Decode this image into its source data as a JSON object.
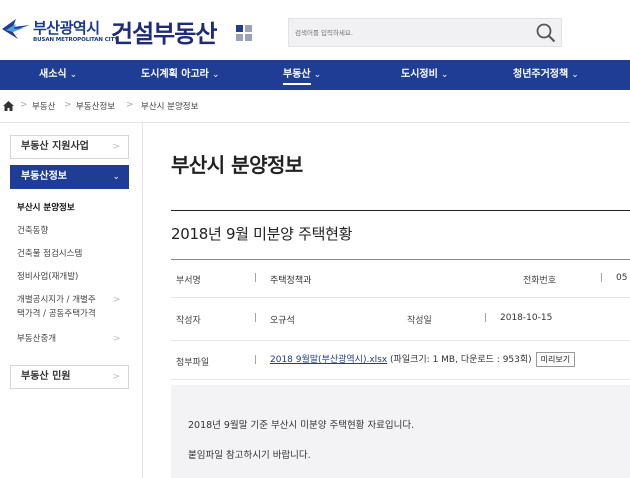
{
  "header": {
    "logo_korean": "부산광역시",
    "logo_english": "BUSAN METROPOLITAN CITY",
    "site_title": "건설부동산",
    "search_placeholder": "검색어를 입력하세요.",
    "brand_color": "#1f3d94"
  },
  "gnb": [
    {
      "label": "새소식",
      "chevron": "⌄"
    },
    {
      "label": "도시계획 아고라",
      "chevron": "⌄"
    },
    {
      "label": "부동산",
      "chevron": "⌄",
      "active": true
    },
    {
      "label": "도시정비",
      "chevron": "⌄"
    },
    {
      "label": "청년주거정책",
      "chevron": "⌄"
    }
  ],
  "breadcrumb": {
    "sep": ">",
    "items": [
      "부동산",
      "부동산정보",
      "부산시 분양정보"
    ]
  },
  "sidebar": {
    "box1": {
      "label": "부동산 지원사업",
      "chevron": ">"
    },
    "box2": {
      "label": "부동산정보",
      "chevron": "⌄"
    },
    "sub": [
      {
        "label": "부산시 분양정보"
      },
      {
        "label": "건축동향"
      },
      {
        "label": "건축물 점검시스템"
      },
      {
        "label": "정비사업(재개발)"
      },
      {
        "label_line1": "개별공시지가 / 개별주",
        "label_line2": "택가격 / 공동주택가격",
        "chevron": ">"
      },
      {
        "label": "부동산중개",
        "chevron": ">"
      }
    ],
    "box3": {
      "label": "부동산 민원",
      "chevron": ">"
    }
  },
  "content": {
    "page_title": "부산시 분양정보",
    "post_title": "2018년 9월 미분양 주택현황",
    "separator": "|",
    "dept_label": "부서명",
    "dept_value": "주택정책과",
    "phone_label": "전화번호",
    "phone_value": "05",
    "author_label": "작성자",
    "author_value": "오규석",
    "date_label": "작성일",
    "date_value": "2018-10-15",
    "attach_label": "첨부파일",
    "attach_file": "2018 9월말(부산광역시).xlsx",
    "attach_meta": " (파일크기: 1 MB, 다운로드 : 953회)",
    "preview_label": "미리보기",
    "body_line1": "2018년 9월말 기준 부산시 미분양 주택현황 자료입니다.",
    "body_line2": "붙임파일 참고하시기 바랍니다."
  }
}
